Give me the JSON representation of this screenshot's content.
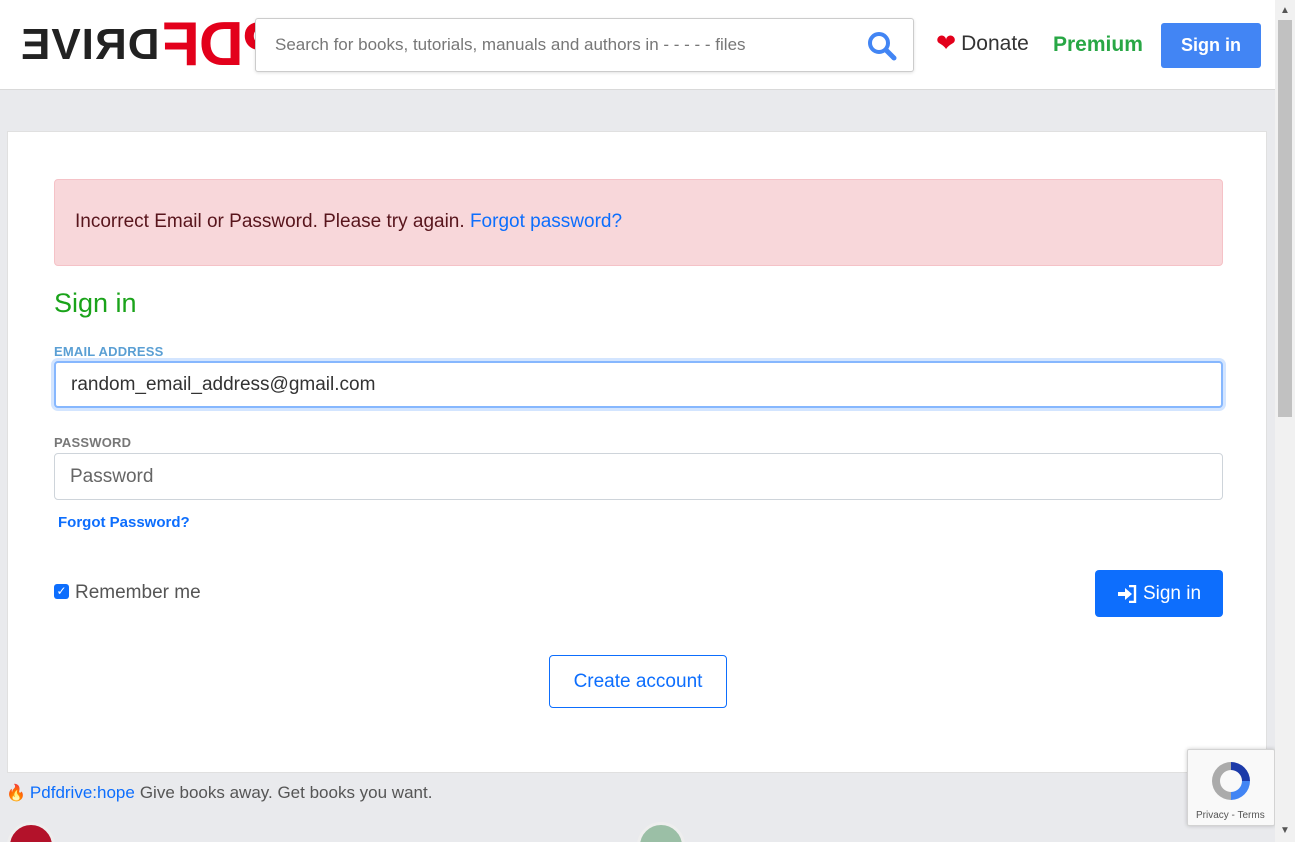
{
  "header": {
    "logo_left": "DRIVE",
    "logo_right": "PDF",
    "search_placeholder": "Search for books, tutorials, manuals and authors in - - - - - files",
    "donate_label": "Donate",
    "premium_label": "Premium",
    "signin_label": "Sign in"
  },
  "alert": {
    "message": "Incorrect Email or Password. Please try again.",
    "link": "Forgot password?"
  },
  "form": {
    "title": "Sign in",
    "email_label": "EMAIL ADDRESS",
    "email_value": "random_email_address@gmail.com",
    "password_label": "PASSWORD",
    "password_placeholder": "Password",
    "forgot_label": "Forgot Password?",
    "remember_label": "Remember me",
    "remember_checked": true,
    "submit_label": "Sign in",
    "create_label": "Create account"
  },
  "footer": {
    "hope_link": "Pdfdrive:hope",
    "hope_text": "Give books away. Get books you want."
  },
  "recaptcha": {
    "terms": "Privacy - Terms"
  },
  "colors": {
    "brand_red": "#e3001b",
    "primary": "#0d6efd",
    "signin_top": "#4285f4",
    "premium": "#28a745",
    "title": "#1aa31a",
    "alert_bg": "#f8d7da"
  }
}
